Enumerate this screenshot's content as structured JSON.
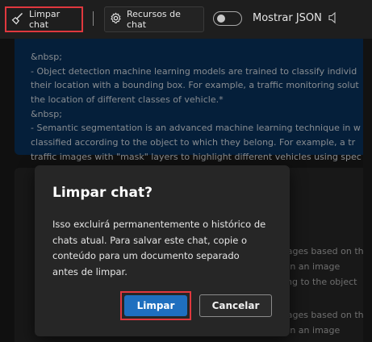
{
  "toolbar": {
    "clear_label": "Limpar chat",
    "resources_label": "Recursos de chat",
    "json_toggle_label": "Mostrar JSON",
    "json_toggle_on": false,
    "icons": {
      "clear": "broom-icon",
      "resources": "gear-icon",
      "speaker": "speaker-icon"
    }
  },
  "chat": {
    "assistant_lines": [
      "&nbsp;",
      "- Object detection machine learning models are trained to classify individ",
      "their location with a bounding box. For example, a traffic monitoring solut",
      "the location of different classes of vehicle.*",
      "&nbsp;",
      "- Semantic segmentation is an advanced machine learning technique in w",
      "classified according to the object to which they belong. For example, a tr",
      "traffic images with \"mask\" layers to highlight different vehicles using spec"
    ],
    "partial_lines": [
      "mages based on th",
      "thin an image",
      "ding to the object",
      "mages based on th",
      "thin an image"
    ]
  },
  "dialog": {
    "title": "Limpar chat?",
    "body_lines": [
      "Isso excluirá permanentemente o histórico de",
      "chats atual. Para salvar este chat, copie o",
      "conteúdo para um documento separado",
      "antes de limpar."
    ],
    "confirm_label": "Limpar",
    "cancel_label": "Cancelar"
  },
  "colors": {
    "highlight": "#e0383e",
    "primary": "#1f6fbf",
    "assistant_bubble": "#08315a"
  }
}
